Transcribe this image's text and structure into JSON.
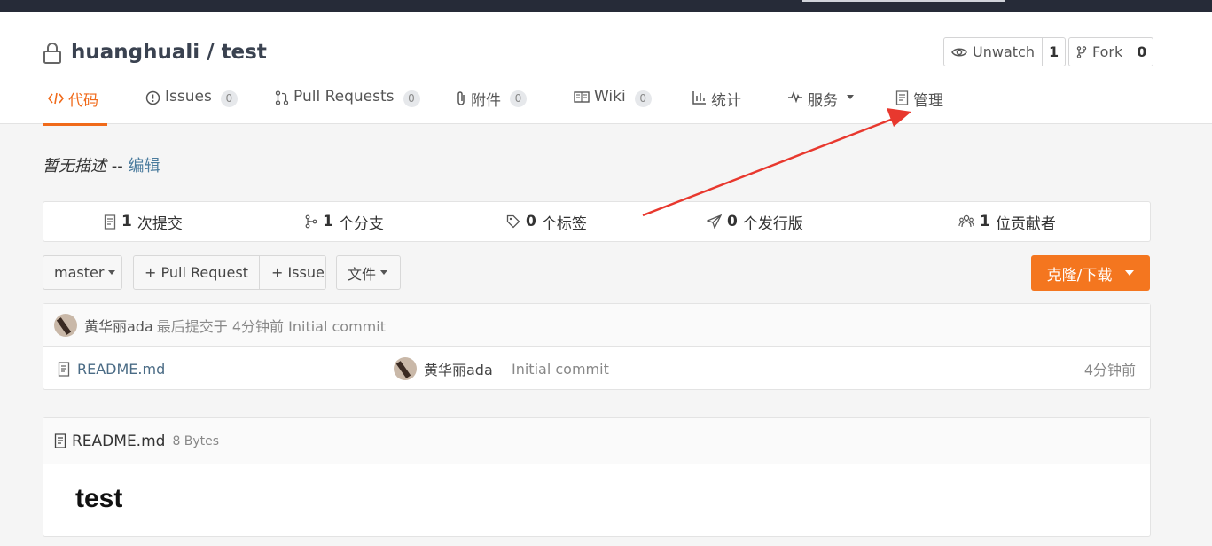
{
  "repo": {
    "owner": "huanghuali",
    "separator": "/",
    "name": "test"
  },
  "actions": {
    "watch": {
      "label": "Unwatch",
      "count": "1"
    },
    "fork": {
      "label": "Fork",
      "count": "0"
    }
  },
  "tabs": [
    {
      "label": "代码",
      "icon": "code-icon",
      "active": true
    },
    {
      "label": "Issues",
      "badge": "0",
      "icon": "issue-icon"
    },
    {
      "label": "Pull Requests",
      "badge": "0",
      "icon": "pull-request-icon"
    },
    {
      "label": "附件",
      "badge": "0",
      "icon": "paperclip-icon"
    },
    {
      "label": "Wiki",
      "badge": "0",
      "icon": "book-icon"
    },
    {
      "label": "统计",
      "icon": "bar-chart-icon"
    },
    {
      "label": "服务",
      "icon": "pulse-icon",
      "dropdown": true
    },
    {
      "label": "管理",
      "icon": "document-icon"
    }
  ],
  "description": {
    "text": "暂无描述",
    "separator": "--",
    "edit_link": "编辑"
  },
  "stats": [
    {
      "value": "1",
      "label": "次提交",
      "icon": "commit-icon"
    },
    {
      "value": "1",
      "label": "个分支",
      "icon": "branch-icon"
    },
    {
      "value": "0",
      "label": "个标签",
      "icon": "tag-icon"
    },
    {
      "value": "0",
      "label": "个发行版",
      "icon": "send-icon"
    },
    {
      "value": "1",
      "label": "位贡献者",
      "icon": "users-icon"
    }
  ],
  "toolbar": {
    "branch": "master",
    "pull_request": "+ Pull Request",
    "issue": "+ Issue",
    "file": "文件",
    "clone": "克隆/下载"
  },
  "latest_commit": {
    "author": "黄华丽ada",
    "text": "最后提交于 4分钟前 Initial commit"
  },
  "files": [
    {
      "name": "README.md",
      "author": "黄华丽ada",
      "message": "Initial commit",
      "time": "4分钟前"
    }
  ],
  "readme": {
    "filename": "README.md",
    "size": "8 Bytes",
    "heading": "test"
  },
  "colors": {
    "accent": "#f06a1a",
    "clone_button": "#f4761f",
    "arrow": "#e8382e",
    "topbar": "#262b38"
  }
}
